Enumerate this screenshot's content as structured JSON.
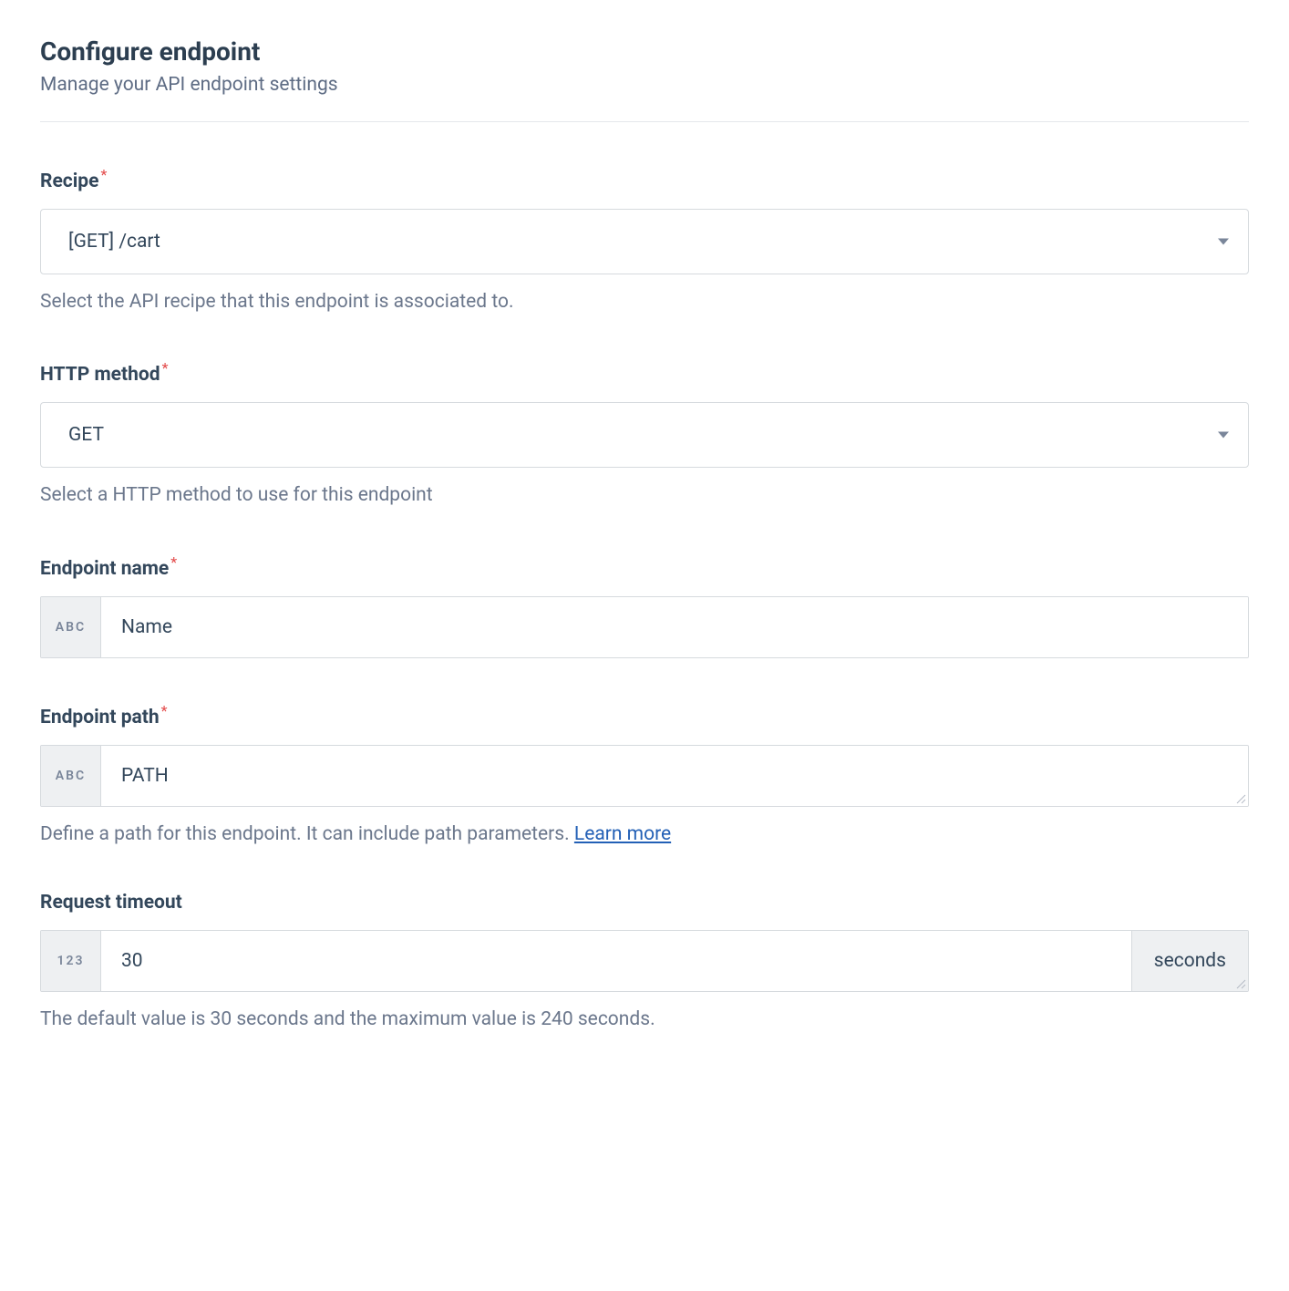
{
  "header": {
    "title": "Configure endpoint",
    "subtitle": "Manage your API endpoint settings"
  },
  "fields": {
    "recipe": {
      "label": "Recipe",
      "required": true,
      "value": "[GET] /cart",
      "help": "Select the API recipe that this endpoint is associated to."
    },
    "http_method": {
      "label": "HTTP method",
      "required": true,
      "value": "GET",
      "help": "Select a HTTP method to use for this endpoint"
    },
    "endpoint_name": {
      "label": "Endpoint name",
      "required": true,
      "prefix": "ABC",
      "placeholder": "Name",
      "value": ""
    },
    "endpoint_path": {
      "label": "Endpoint path",
      "required": true,
      "prefix": "ABC",
      "placeholder": "PATH",
      "value": "",
      "help": "Define a path for this endpoint. It can include path parameters. ",
      "learn_more": "Learn more"
    },
    "request_timeout": {
      "label": "Request timeout",
      "required": false,
      "prefix": "123",
      "value": "30",
      "suffix": "seconds",
      "help": "The default value is 30 seconds and the maximum value is 240 seconds."
    }
  }
}
